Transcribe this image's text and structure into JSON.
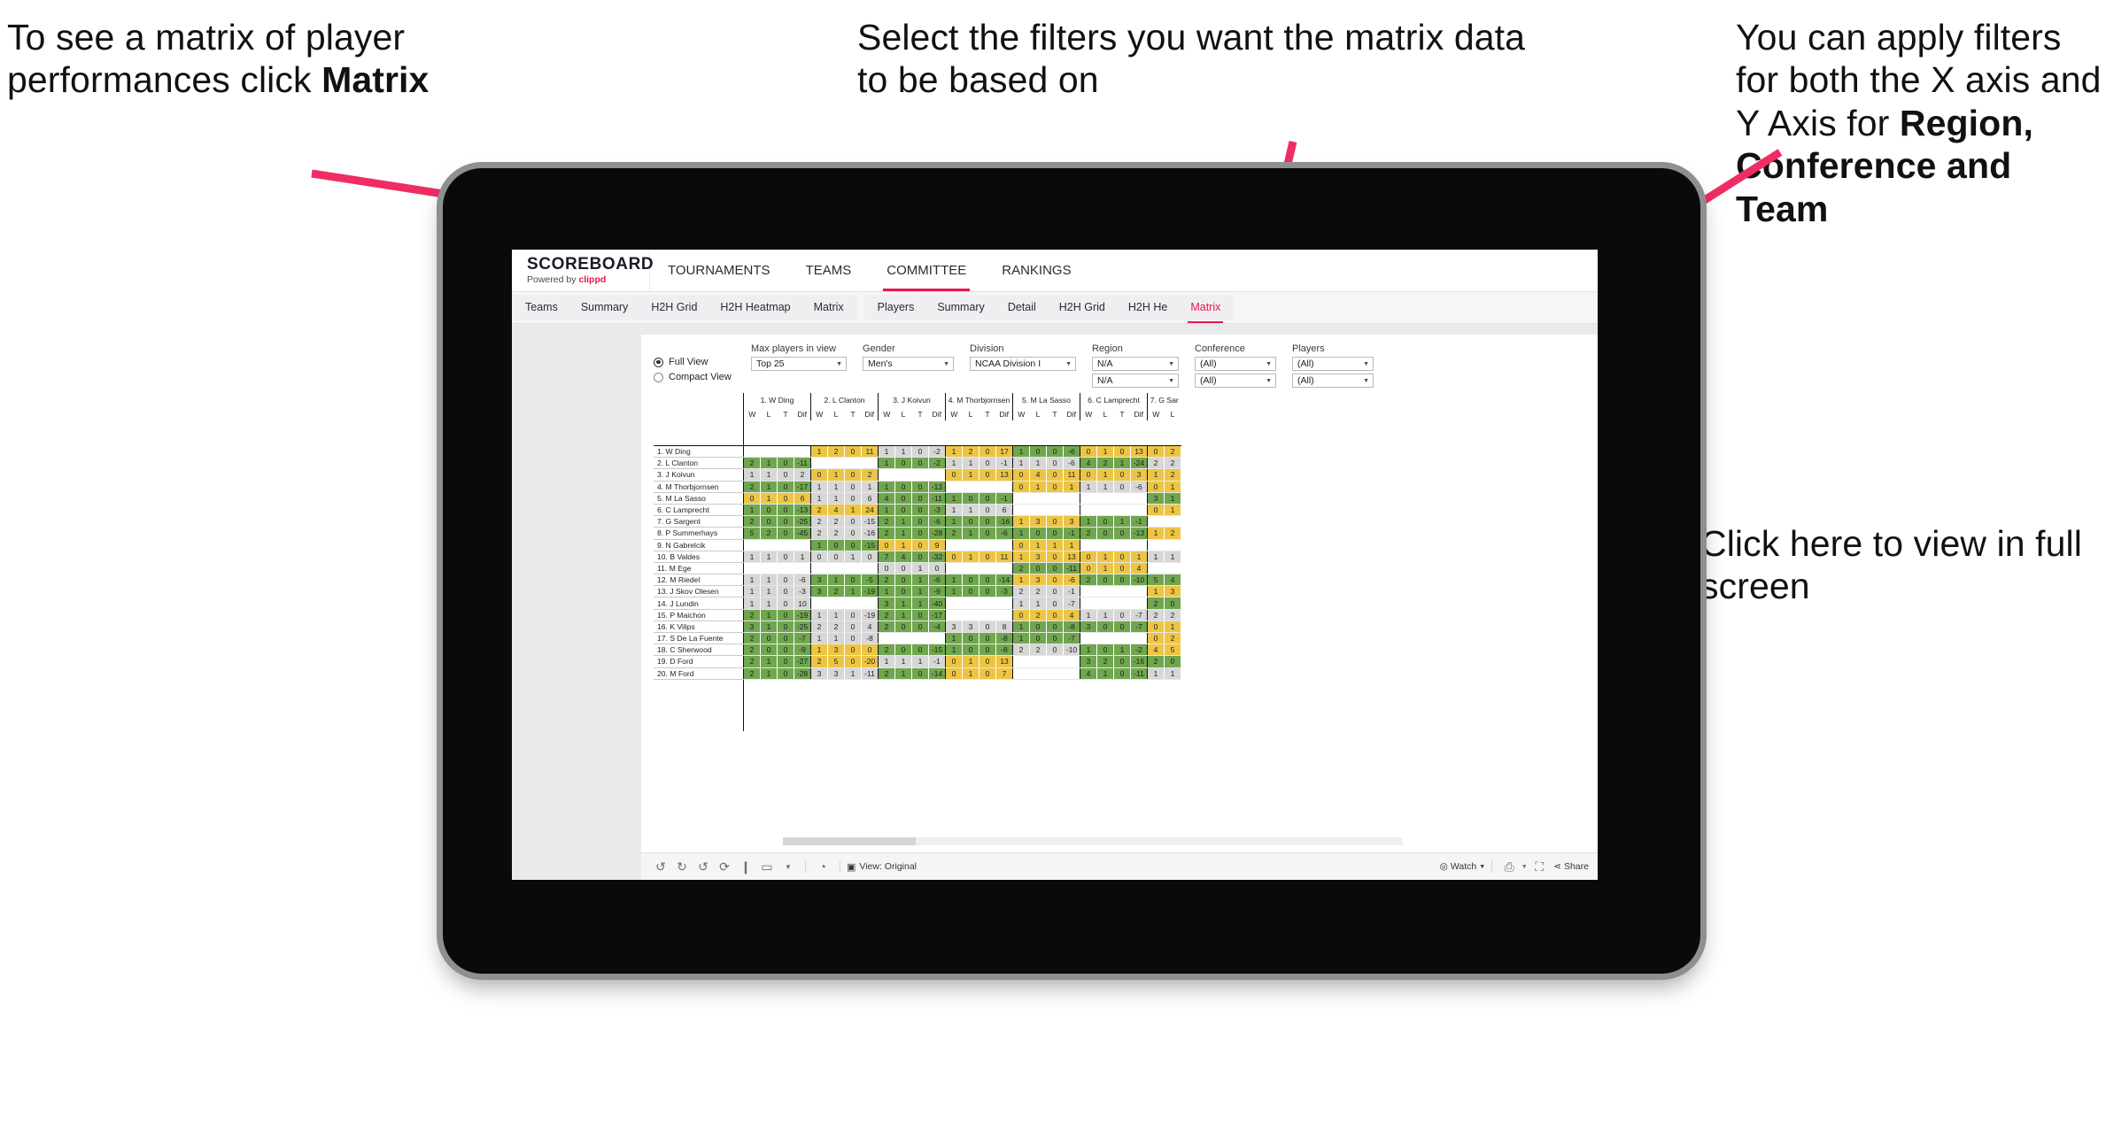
{
  "annotations": {
    "top_left": {
      "pre": "To see a matrix of player performances click ",
      "bold": "Matrix"
    },
    "top_middle": {
      "text": "Select the filters you want the matrix data to be based on"
    },
    "top_right": {
      "pre": "You  can apply filters for both the X axis and Y Axis for ",
      "bold": "Region, Conference and Team"
    },
    "bottom_right": {
      "text": "Click here to view in full screen"
    }
  },
  "brand": {
    "name": "SCOREBOARD",
    "powered_prefix": "Powered by ",
    "powered_brand": "clippd"
  },
  "topnav": {
    "items": [
      {
        "label": "TOURNAMENTS",
        "active": false
      },
      {
        "label": "TEAMS",
        "active": false
      },
      {
        "label": "COMMITTEE",
        "active": true
      },
      {
        "label": "RANKINGS",
        "active": false
      }
    ]
  },
  "subnav": {
    "group_teams": [
      {
        "label": "Teams",
        "active": false
      },
      {
        "label": "Summary",
        "active": false
      },
      {
        "label": "H2H Grid",
        "active": false
      },
      {
        "label": "H2H Heatmap",
        "active": false
      },
      {
        "label": "Matrix",
        "active": false
      }
    ],
    "group_players": [
      {
        "label": "Players",
        "active": false
      },
      {
        "label": "Summary",
        "active": false
      },
      {
        "label": "Detail",
        "active": false
      },
      {
        "label": "H2H Grid",
        "active": false
      },
      {
        "label": "H2H He",
        "active": false
      },
      {
        "label": "Matrix",
        "active": true
      }
    ]
  },
  "filters": {
    "view_modes": [
      {
        "label": "Full View",
        "selected": true
      },
      {
        "label": "Compact View",
        "selected": false
      }
    ],
    "max_players": {
      "label": "Max players in view",
      "value": "Top 25"
    },
    "gender": {
      "label": "Gender",
      "value": "Men's"
    },
    "division": {
      "label": "Division",
      "value": "NCAA Division I"
    },
    "region": {
      "label": "Region",
      "value_x": "N/A",
      "value_y": "N/A"
    },
    "conference": {
      "label": "Conference",
      "value_x": "(All)",
      "value_y": "(All)"
    },
    "players": {
      "label": "Players",
      "value_x": "(All)",
      "value_y": "(All)"
    }
  },
  "chart_data": {
    "type": "heatmap",
    "title": "Player head-to-head performance matrix",
    "subcolumns": [
      "W",
      "L",
      "T",
      "Dif"
    ],
    "columns": [
      "1. W Ding",
      "2. L Clanton",
      "3. J Koivun",
      "4. M Thorbjornsen",
      "5. M La Sasso",
      "6. C Lamprecht",
      "7. G Sar"
    ],
    "rows": [
      "1. W Ding",
      "2. L Clanton",
      "3. J Koivun",
      "4. M Thorbjornsen",
      "5. M La Sasso",
      "6. C Lamprecht",
      "7. G Sargent",
      "8. P Summerhays",
      "9. N Gabrelcik",
      "10. B Valdes",
      "11. M Ege",
      "12. M Riedel",
      "13. J Skov Olesen",
      "14. J Lundin",
      "15. P Maichon",
      "16. K Vilips",
      "17. S De La Fuente",
      "18. C Sherwood",
      "19. D Ford",
      "20. M Ford"
    ],
    "color_legend": {
      "win": "#6fa64e",
      "loss": "#edc544",
      "neutral": "#d7d7d7",
      "empty": "#ffffff"
    },
    "cells": [
      [
        null,
        [
          "y",
          1,
          2,
          0,
          11
        ],
        [
          "n",
          1,
          1,
          0,
          -2
        ],
        [
          "y",
          1,
          2,
          0,
          17
        ],
        [
          "g",
          1,
          0,
          0,
          -6
        ],
        [
          "y",
          0,
          1,
          0,
          13
        ],
        [
          "y",
          0,
          2
        ]
      ],
      [
        [
          "g",
          2,
          1,
          0,
          -11
        ],
        null,
        [
          "g",
          1,
          0,
          0,
          -2
        ],
        [
          "n",
          1,
          1,
          0,
          -1
        ],
        [
          "n",
          1,
          1,
          0,
          -6
        ],
        [
          "g",
          4,
          2,
          1,
          -24
        ],
        [
          "n",
          2,
          2
        ]
      ],
      [
        [
          "n",
          1,
          1,
          0,
          2
        ],
        [
          "y",
          0,
          1,
          0,
          2
        ],
        null,
        [
          "y",
          0,
          1,
          0,
          13
        ],
        [
          "y",
          0,
          4,
          0,
          11
        ],
        [
          "y",
          0,
          1,
          0,
          3
        ],
        [
          "y",
          1,
          2
        ]
      ],
      [
        [
          "g",
          2,
          1,
          0,
          -17
        ],
        [
          "n",
          1,
          1,
          0,
          1
        ],
        [
          "g",
          1,
          0,
          0,
          -13
        ],
        null,
        [
          "y",
          0,
          1,
          0,
          1
        ],
        [
          "n",
          1,
          1,
          0,
          -6
        ],
        [
          "y",
          0,
          1
        ]
      ],
      [
        [
          "y",
          0,
          1,
          0,
          6
        ],
        [
          "n",
          1,
          1,
          0,
          6
        ],
        [
          "g",
          4,
          0,
          0,
          -11
        ],
        [
          "g",
          1,
          0,
          0,
          -1
        ],
        null,
        null,
        [
          "g",
          3,
          1
        ]
      ],
      [
        [
          "g",
          1,
          0,
          0,
          -13
        ],
        [
          "y",
          2,
          4,
          1,
          24
        ],
        [
          "g",
          1,
          0,
          0,
          -3
        ],
        [
          "n",
          1,
          1,
          0,
          6
        ],
        null,
        null,
        [
          "y",
          0,
          1
        ]
      ],
      [
        [
          "g",
          2,
          0,
          0,
          -25
        ],
        [
          "n",
          2,
          2,
          0,
          -15
        ],
        [
          "g",
          2,
          1,
          0,
          -6
        ],
        [
          "g",
          1,
          0,
          0,
          -16
        ],
        [
          "y",
          1,
          3,
          0,
          3
        ],
        [
          "g",
          1,
          0,
          1,
          -1
        ],
        null
      ],
      [
        [
          "g",
          5,
          2,
          0,
          -45
        ],
        [
          "n",
          2,
          2,
          0,
          -16
        ],
        [
          "g",
          2,
          1,
          0,
          -28
        ],
        [
          "g",
          2,
          1,
          0,
          -6
        ],
        [
          "g",
          1,
          0,
          0,
          -1
        ],
        [
          "g",
          2,
          0,
          0,
          -13
        ],
        [
          "y",
          1,
          2
        ]
      ],
      [
        null,
        [
          "g",
          1,
          0,
          0,
          -15
        ],
        [
          "y",
          0,
          1,
          0,
          9
        ],
        null,
        [
          "y",
          0,
          1,
          1,
          1
        ],
        null,
        null
      ],
      [
        [
          "n",
          1,
          1,
          0,
          1
        ],
        [
          "n",
          0,
          0,
          1,
          0
        ],
        [
          "g",
          7,
          4,
          0,
          -32
        ],
        [
          "y",
          0,
          1,
          0,
          11
        ],
        [
          "y",
          1,
          3,
          0,
          13
        ],
        [
          "y",
          0,
          1,
          0,
          1
        ],
        [
          "n",
          1,
          1
        ]
      ],
      [
        null,
        null,
        [
          "n",
          0,
          0,
          1,
          0
        ],
        null,
        [
          "g",
          2,
          0,
          0,
          -11
        ],
        [
          "y",
          0,
          1,
          0,
          4
        ],
        null
      ],
      [
        [
          "n",
          1,
          1,
          0,
          -6
        ],
        [
          "g",
          3,
          1,
          0,
          -5
        ],
        [
          "g",
          2,
          0,
          1,
          -6
        ],
        [
          "g",
          1,
          0,
          0,
          -14
        ],
        [
          "y",
          1,
          3,
          0,
          -6
        ],
        [
          "g",
          2,
          0,
          0,
          -10
        ],
        [
          "g",
          5,
          4
        ]
      ],
      [
        [
          "n",
          1,
          1,
          0,
          -3
        ],
        [
          "g",
          3,
          2,
          1,
          -19
        ],
        [
          "g",
          1,
          0,
          1,
          -9
        ],
        [
          "g",
          1,
          0,
          0,
          -3
        ],
        [
          "n",
          2,
          2,
          0,
          -1
        ],
        null,
        [
          "y",
          1,
          3
        ]
      ],
      [
        [
          "n",
          1,
          1,
          0,
          10
        ],
        null,
        [
          "g",
          3,
          1,
          1,
          -40
        ],
        null,
        [
          "n",
          1,
          1,
          0,
          -7
        ],
        null,
        [
          "g",
          2,
          0
        ]
      ],
      [
        [
          "g",
          2,
          1,
          0,
          -19
        ],
        [
          "n",
          1,
          1,
          0,
          -19
        ],
        [
          "g",
          2,
          1,
          0,
          -17
        ],
        null,
        [
          "y",
          0,
          2,
          0,
          4
        ],
        [
          "n",
          1,
          1,
          0,
          -7
        ],
        [
          "n",
          2,
          2
        ]
      ],
      [
        [
          "g",
          3,
          1,
          0,
          -25
        ],
        [
          "n",
          2,
          2,
          0,
          4
        ],
        [
          "g",
          2,
          0,
          0,
          -4
        ],
        [
          "n",
          3,
          3,
          0,
          8
        ],
        [
          "g",
          1,
          0,
          0,
          -8
        ],
        [
          "g",
          3,
          0,
          0,
          -7
        ],
        [
          "y",
          0,
          1
        ]
      ],
      [
        [
          "g",
          2,
          0,
          0,
          -7
        ],
        [
          "n",
          1,
          1,
          0,
          -8
        ],
        null,
        [
          "g",
          1,
          0,
          0,
          -8
        ],
        [
          "g",
          1,
          0,
          0,
          -7
        ],
        null,
        [
          "y",
          0,
          2
        ]
      ],
      [
        [
          "g",
          2,
          0,
          0,
          -9
        ],
        [
          "y",
          1,
          3,
          0,
          0
        ],
        [
          "g",
          2,
          0,
          0,
          -15
        ],
        [
          "g",
          1,
          0,
          0,
          -8
        ],
        [
          "n",
          2,
          2,
          0,
          -10
        ],
        [
          "g",
          1,
          0,
          1,
          -2
        ],
        [
          "y",
          4,
          5
        ]
      ],
      [
        [
          "g",
          2,
          1,
          0,
          -27
        ],
        [
          "y",
          2,
          5,
          0,
          -20
        ],
        [
          "n",
          1,
          1,
          1,
          -1
        ],
        [
          "y",
          0,
          1,
          0,
          13
        ],
        null,
        [
          "g",
          3,
          2,
          0,
          -16
        ],
        [
          "g",
          2,
          0
        ]
      ],
      [
        [
          "g",
          2,
          1,
          0,
          -28
        ],
        [
          "n",
          3,
          3,
          1,
          -11
        ],
        [
          "g",
          2,
          1,
          0,
          -14
        ],
        [
          "y",
          0,
          1,
          0,
          7
        ],
        null,
        [
          "g",
          4,
          1,
          0,
          -11
        ],
        [
          "n",
          1,
          1
        ]
      ]
    ]
  },
  "bottom_toolbar": {
    "view_label": "View: Original",
    "watch_label": "Watch",
    "share_label": "Share",
    "icons": [
      "undo-icon",
      "redo-icon",
      "revert-icon",
      "refresh-icon",
      "pause-icon",
      "shape-icon",
      "dropdown-caret-icon",
      "clock-icon",
      "view-icon",
      "watch-icon",
      "device-icon",
      "fullscreen-icon",
      "share-icon"
    ]
  }
}
